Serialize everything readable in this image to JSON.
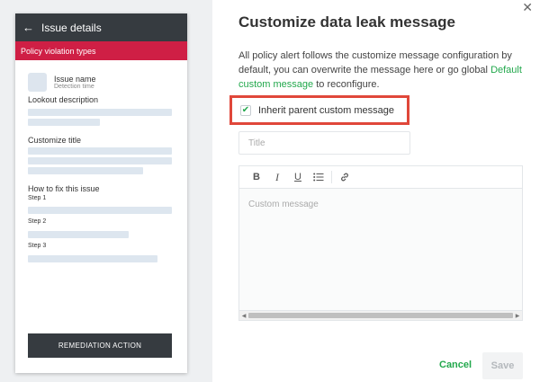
{
  "preview": {
    "header_title": "Issue details",
    "banner": "Policy violation types",
    "issue_name": "Issue name",
    "detection_time": "Detection time",
    "lookout_label": "Lookout description",
    "customize_title_label": "Customize title",
    "how_to_fix_label": "How to fix this issue",
    "step1": "Step 1",
    "step2": "Step 2",
    "step3": "Step 3",
    "remediation_button": "REMEDIATION ACTION"
  },
  "modal": {
    "title": "Customize data leak message",
    "desc_prefix": "All policy alert follows the customize message configuration by default, you can overwrite the message here or go global ",
    "desc_link": "Default custom message",
    "desc_suffix": " to reconfigure.",
    "inherit_label": "Inherit parent custom message",
    "inherit_checked": true,
    "title_placeholder": "Title",
    "message_placeholder": "Custom message",
    "cancel_label": "Cancel",
    "save_label": "Save"
  },
  "icons": {
    "back": "arrow-left-icon",
    "close": "close-icon",
    "check": "check-icon",
    "bold": "bold-icon",
    "italic": "italic-icon",
    "underline": "underline-icon",
    "list": "bullet-list-icon",
    "link": "link-icon"
  },
  "colors": {
    "accent_green": "#22a84c",
    "banner_red": "#cf1f45",
    "highlight_red": "#e0473a",
    "dark_header": "#363b40"
  }
}
